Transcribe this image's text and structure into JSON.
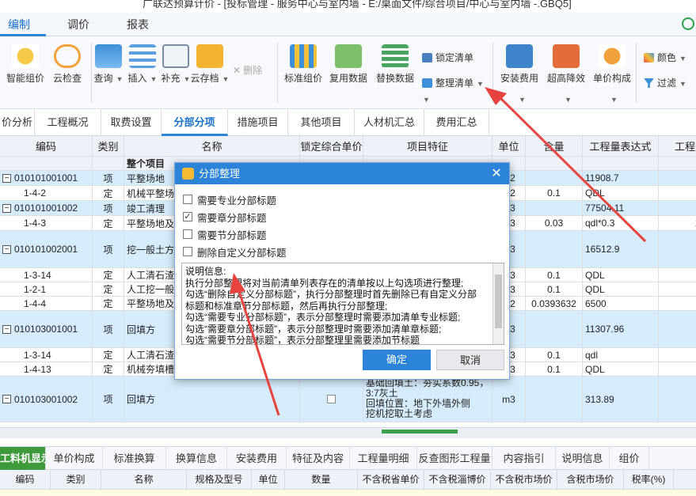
{
  "window": {
    "title": "广联达预算计价 - [投标管理 - 服务中心与室内墙 - E:/桌面文件/综合项目/中心与室内墙 -.GBQ5]"
  },
  "menu": {
    "tabs": [
      "编制",
      "调价",
      "报表"
    ]
  },
  "toolbar": {
    "buttons": [
      "智能组价",
      "云检查",
      "查询",
      "插入",
      "补充",
      "云存档",
      "标准组价",
      "复用数据",
      "替换数据",
      "安装费用",
      "超高降效",
      "单价构成"
    ],
    "delete_label": "删除",
    "lock_list": "锁定清单",
    "organize_list": "整理清单",
    "color": "颜色",
    "filter": "过滤"
  },
  "subtabs": [
    "价分析",
    "工程概况",
    "取费设置",
    "分部分项",
    "措施项目",
    "其他项目",
    "人材机汇总",
    "费用汇总"
  ],
  "grid": {
    "headers": [
      "编码",
      "类别",
      "名称",
      "锁定综合单价",
      "项目特征",
      "单位",
      "含量",
      "工程量表达式",
      "工程量"
    ],
    "section_label": "整个项目",
    "rows": [
      {
        "code": "010101001001",
        "type": "项",
        "name": "平整场地",
        "unit": "m2",
        "qty_ratio": "",
        "expr": "11908.7",
        "quantity": "119"
      },
      {
        "code": "1-4-2",
        "type": "定",
        "name": "机械平整场",
        "unit": "m2",
        "qty_ratio": "0.1",
        "expr": "QDL",
        "quantity": "119"
      },
      {
        "code": "010101001002",
        "type": "项",
        "name": "竣工清理",
        "unit": "m3",
        "qty_ratio": "",
        "expr": "77504.11",
        "quantity": "7750"
      },
      {
        "code": "1-4-3",
        "type": "定",
        "name": "平整场地及",
        "unit": "m3",
        "qty_ratio": "0.03",
        "expr": "qdl*0.3",
        "quantity": "2325."
      },
      {
        "code": "010101002001",
        "type": "项",
        "name": "挖一般土方",
        "unit": "m3",
        "qty_ratio": "",
        "expr": "16512.9",
        "quantity": "165"
      },
      {
        "code": "1-3-14",
        "type": "定",
        "name": "人工清石渣",
        "unit": "m3",
        "qty_ratio": "0.1",
        "expr": "QDL",
        "quantity": "165"
      },
      {
        "code": "1-2-1",
        "type": "定",
        "name": "人工挖一般",
        "unit": "m3",
        "qty_ratio": "0.1",
        "expr": "QDL",
        "quantity": "165"
      },
      {
        "code": "1-4-4",
        "type": "定",
        "name": "平整场地及",
        "unit": "m2",
        "qty_ratio": "0.0393632",
        "expr": "6500",
        "quantity": "165"
      },
      {
        "code": "010103001001",
        "type": "项",
        "name": "回填方",
        "unit": "m3",
        "qty_ratio": "",
        "expr": "11307.96",
        "quantity": "1130"
      },
      {
        "code": "1-3-14",
        "type": "定",
        "name": "人工清石渣",
        "unit": "m3",
        "qty_ratio": "0.1",
        "expr": "qdl",
        "quantity": "1130"
      },
      {
        "code": "1-4-13",
        "type": "定",
        "name": "机械夯填槽",
        "unit": "m3",
        "qty_ratio": "0.1",
        "expr": "QDL",
        "quantity": "1130"
      },
      {
        "code": "010103001002",
        "type": "项",
        "name": "回填方",
        "unit": "m3",
        "qty_ratio": "",
        "expr": "313.89",
        "quantity": "3"
      }
    ],
    "last_feature": [
      "基础回填土：夯实系数0.95，",
      "3:7灰土",
      "回填位置：地下外墙外侧",
      "挖机挖取土考虑"
    ]
  },
  "bottom_tabs": [
    "工料机显示",
    "单价构成",
    "标准换算",
    "换算信息",
    "安装费用",
    "特征及内容",
    "工程量明细",
    "反查图形工程量",
    "内容指引",
    "说明信息",
    "组价"
  ],
  "bottom_headers": [
    "编码",
    "类别",
    "名称",
    "规格及型号",
    "单位",
    "数量",
    "不含税省单价",
    "不含税淄博价",
    "不含税市场价",
    "含税市场价",
    "税率(%)"
  ],
  "dialog": {
    "title": "分部整理",
    "options": [
      {
        "label": "需要专业分部标题",
        "checked": false
      },
      {
        "label": "需要章分部标题",
        "checked": true
      },
      {
        "label": "需要节分部标题",
        "checked": false
      },
      {
        "label": "删除自定义分部标题",
        "checked": false
      }
    ],
    "info_lines": [
      "说明信息:",
      "执行分部整理将对当前清单列表存在的清单按以上勾选项进行整理;",
      "勾选“删除自定义分部标题”，执行分部整理时首先删除已有自定义分部",
      "标题和标准章节分部标题，然后再执行分部整理;",
      "勾选“需要专业分部标题”，表示分部整理时需要添加清单专业标题;",
      "勾选“需要章分部标题”，表示分部整理时需要添加清单章标题;",
      "勾选“需要节分部标题”，表示分部整理里需要添加节标题"
    ],
    "ok": "确定",
    "cancel": "取消"
  },
  "colors": {
    "accent": "#2b84d8",
    "row_blue": "#d6ecfb",
    "arrow": "#e8443f",
    "green_tab": "#3e9a3a"
  }
}
